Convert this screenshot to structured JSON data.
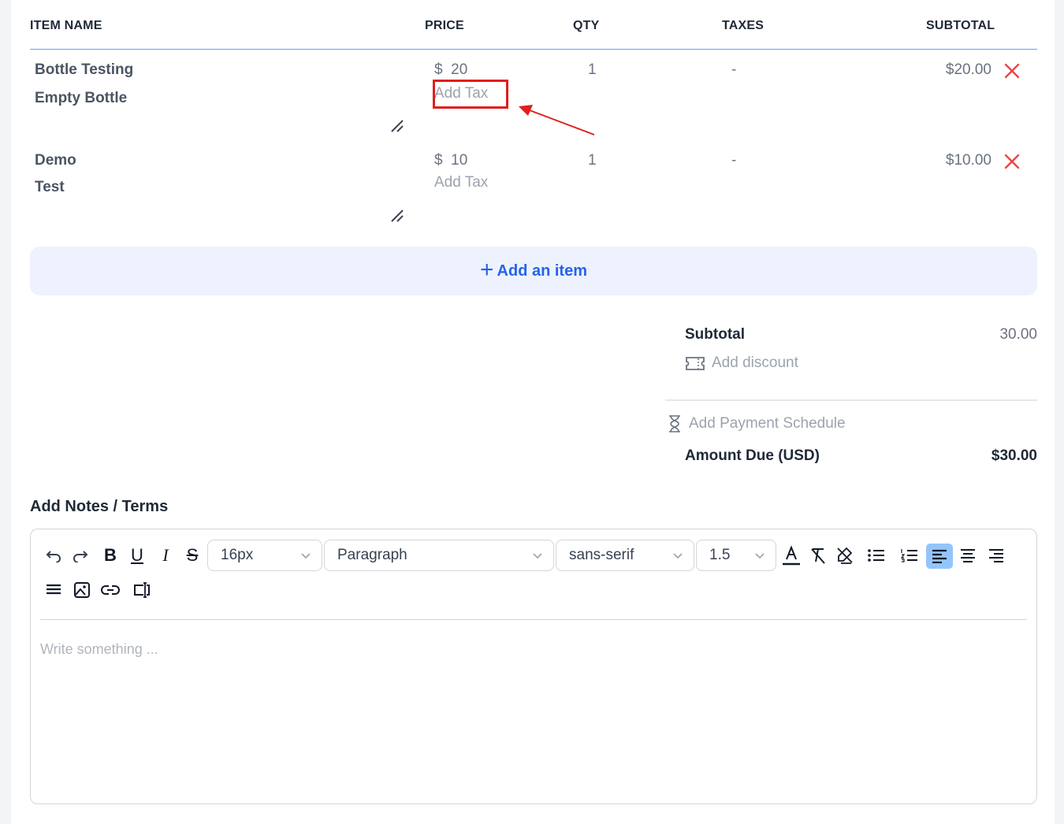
{
  "table": {
    "headers": {
      "item_name": "ITEM NAME",
      "price": "PRICE",
      "qty": "QTY",
      "taxes": "TAXES",
      "subtotal": "SUBTOTAL"
    },
    "rows": [
      {
        "name": "Bottle Testing",
        "description": "Empty Bottle",
        "currency": "$",
        "price": "20",
        "add_tax": "Add Tax",
        "qty": "1",
        "taxes": "-",
        "subtotal": "$20.00"
      },
      {
        "name": "Demo",
        "description": "Test",
        "currency": "$",
        "price": "10",
        "add_tax": "Add Tax",
        "qty": "1",
        "taxes": "-",
        "subtotal": "$10.00"
      }
    ]
  },
  "add_item_label": "Add an item",
  "summary": {
    "subtotal_label": "Subtotal",
    "subtotal_value": "30.00",
    "add_discount": "Add discount",
    "add_payment_schedule": "Add Payment Schedule",
    "amount_due_label": "Amount Due (USD)",
    "amount_due_value": "$30.00"
  },
  "notes": {
    "title": "Add Notes / Terms",
    "placeholder": "Write something ...",
    "font_size": "16px",
    "block_type": "Paragraph",
    "font_family": "sans-serif",
    "line_height": "1.5"
  },
  "colors": {
    "accent": "#2563eb",
    "delete": "#ef4444",
    "annotation": "#e11d1d",
    "header_line": "#60a5fa"
  }
}
